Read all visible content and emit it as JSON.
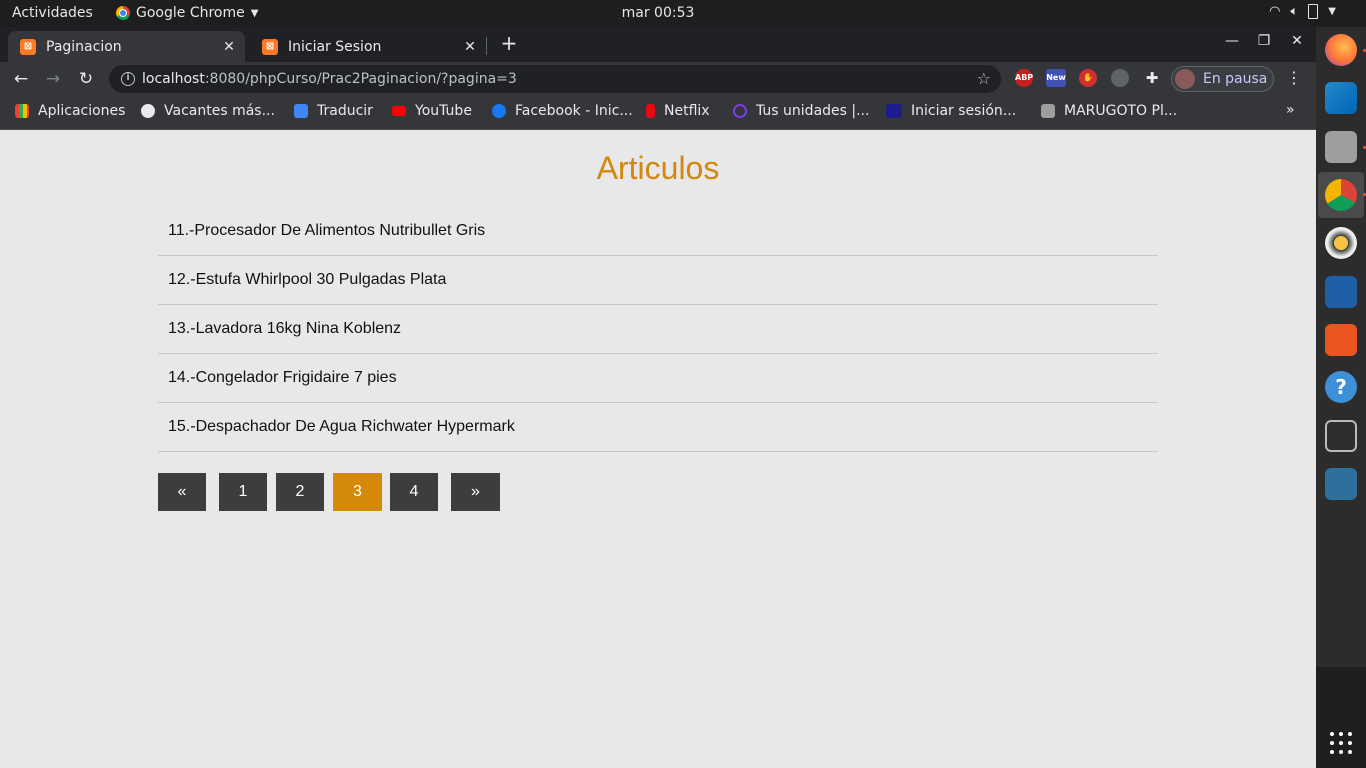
{
  "topbar": {
    "activities": "Actividades",
    "app_name": "Google Chrome",
    "clock": "mar 00:53"
  },
  "tabs": [
    {
      "title": "Paginacion",
      "close": "✕"
    },
    {
      "title": "Iniciar Sesion",
      "close": "✕"
    }
  ],
  "toolbar": {
    "url_host": "localhost",
    "url_rest": ":8080/phpCurso/Prac2Paginacion/?pagina=3",
    "profile_label": "En pausa"
  },
  "bookmarks": [
    {
      "label": "Aplicaciones",
      "color": "#4285f4"
    },
    {
      "label": "Vacantes más...",
      "color": "#e8eaed"
    },
    {
      "label": "Traducir",
      "color": "#4285f4"
    },
    {
      "label": "YouTube",
      "color": "#ff0000"
    },
    {
      "label": "Facebook - Inic...",
      "color": "#1877f2"
    },
    {
      "label": "Netflix",
      "color": "#e50914"
    },
    {
      "label": "Tus unidades |...",
      "color": "#7b3fe4"
    },
    {
      "label": "Iniciar sesión...",
      "color": "#1c1c8c"
    },
    {
      "label": "MARUGOTO Pl...",
      "color": "#9e9e9e"
    }
  ],
  "page": {
    "title": "Articulos",
    "articles": [
      "11.-Procesador De Alimentos Nutribullet Gris",
      "12.-Estufa Whirlpool 30 Pulgadas Plata",
      "13.-Lavadora 16kg Nina Koblenz",
      "14.-Congelador Frigidaire 7 pies",
      "15.-Despachador De Agua Richwater Hypermark"
    ],
    "pagination": {
      "prev": "«",
      "pages": [
        "1",
        "2",
        "3",
        "4"
      ],
      "current": "3",
      "next": "»"
    }
  },
  "colors": {
    "accent": "#d4890b",
    "title": "#d4870a",
    "pager_bg": "#3d3d3d"
  }
}
